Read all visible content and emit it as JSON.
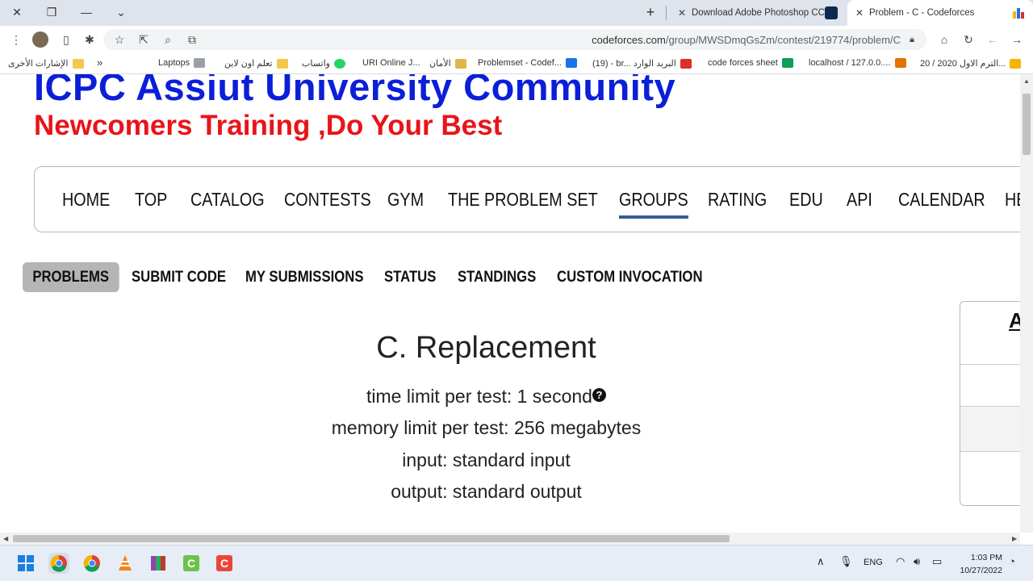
{
  "browser": {
    "tabs": [
      {
        "title": "Download Adobe Photoshop CC",
        "active": false
      },
      {
        "title": "Problem - C - Codeforces",
        "active": true
      }
    ],
    "url_host": "codeforces.com",
    "url_path": "/group/MWSDmqGsZm/contest/219774/problem/C",
    "bookmarks": [
      "الإشارات الأخرى",
      "Laptops",
      "تعلم اون لاين",
      "واتساب",
      "URI Online J...",
      "الأمان",
      "Problemset - Codef...",
      "(19) - br... البريد الوارد",
      "code forces sheet",
      "localhost / 127.0.0....",
      "الترم الاول 2020 / 20..."
    ]
  },
  "page": {
    "header_title": "ICPC Assiut University Community",
    "header_subtitle": "Newcomers Training ,Do Your Best",
    "main_menu": [
      "HOME",
      "TOP",
      "CATALOG",
      "CONTESTS",
      "GYM",
      "THE PROBLEM SET",
      "GROUPS",
      "RATING",
      "EDU",
      "API",
      "CALENDAR",
      "HE"
    ],
    "main_menu_selected": "GROUPS",
    "sub_menu": [
      "PROBLEMS",
      "SUBMIT CODE",
      "MY SUBMISSIONS",
      "STATUS",
      "STANDINGS",
      "CUSTOM INVOCATION"
    ],
    "sub_menu_selected": "PROBLEMS",
    "sidebox_header": "A",
    "problem": {
      "title": "C. Replacement",
      "time_limit": "time limit per test: 1 second",
      "memory_limit": "memory limit per test: 256 megabytes",
      "input": "input: standard input",
      "output": "output: standard output"
    }
  },
  "taskbar": {
    "lang": "ENG",
    "time": "1:03 PM",
    "date": "10/27/2022"
  },
  "colors": {
    "header_title": "#0b1fd9",
    "header_subtitle": "#e8141a",
    "menu_underline": "#3b5998"
  }
}
